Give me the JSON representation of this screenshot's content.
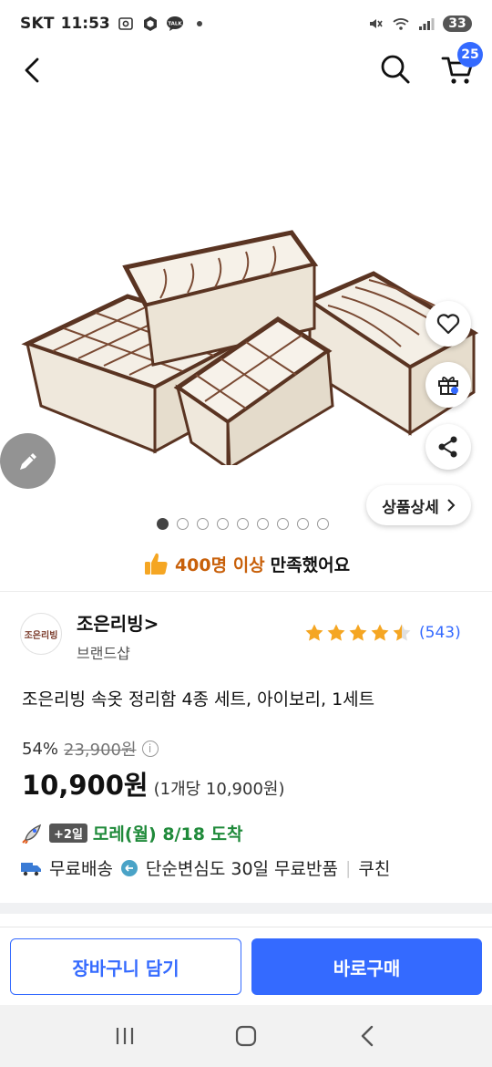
{
  "status_bar": {
    "carrier": "SKT",
    "time": "11:53",
    "battery": "33",
    "icons": [
      "screenshot-icon",
      "cube-app-icon",
      "talk-icon",
      "dot-icon",
      "mute-icon",
      "wifi-icon",
      "signal-icon",
      "battery-icon"
    ]
  },
  "nav": {
    "cart_count": "25",
    "icons": [
      "back-arrow-icon",
      "search-icon",
      "cart-icon"
    ]
  },
  "gallery": {
    "detail_label": "상품상세",
    "image_count": 9,
    "active_index": 0
  },
  "satisfaction": {
    "highlight": "400명 이상",
    "rest": "만족했어요"
  },
  "brand": {
    "logo_text": "조은리빙",
    "name": "조은리빙>",
    "subtitle": "브랜드샵"
  },
  "rating": {
    "stars": 4.5,
    "count": "(543)",
    "star_color": "#f5a623"
  },
  "product": {
    "title": "조은리빙 속옷 정리함 4종 세트, 아이보리, 1세트",
    "discount": "54%",
    "original_price": "23,900원",
    "price": "10,900원",
    "unit_price": "(1개당 10,900원)"
  },
  "delivery": {
    "badge": "+2일",
    "text": "모레(월) 8/18 도착"
  },
  "benefits": {
    "shipping": "무료배송",
    "return": "단순변심도 30일 무료반품",
    "separator": "|",
    "coupang": "쿠친"
  },
  "actions": {
    "cart": "장바구니 담기",
    "buy": "바로구매"
  },
  "colors": {
    "accent": "#346aff",
    "delivery_green": "#1f8a3a",
    "highlight_orange": "#c8600a"
  }
}
